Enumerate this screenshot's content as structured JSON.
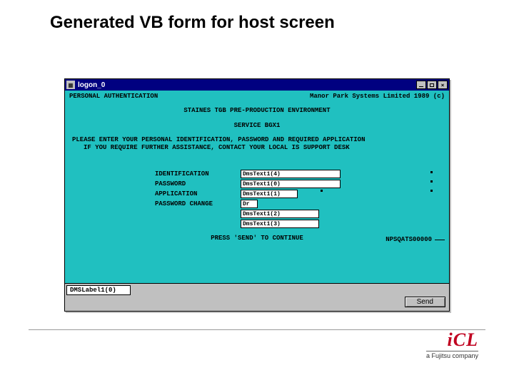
{
  "slide": {
    "title": "Generated VB form for host screen",
    "logo_main": "iCL",
    "logo_sub": "a Fujitsu company"
  },
  "window": {
    "title": "logon_0",
    "controls": {
      "min": "_",
      "max": "□",
      "close": "×"
    }
  },
  "host": {
    "header_left": "PERSONAL AUTHENTICATION",
    "header_right": "Manor Park Systems Limited 1989 (c)",
    "env_line": "STAINES TGB PRE-PRODUCTION ENVIRONMENT",
    "service_line": "SERVICE BGX1",
    "instruct1": "PLEASE ENTER YOUR PERSONAL IDENTIFICATION, PASSWORD AND REQUIRED APPLICATION",
    "instruct2": "IF YOU REQUIRE FURTHER ASSISTANCE, CONTACT YOUR LOCAL IS SUPPORT DESK",
    "labels": {
      "identification": "IDENTIFICATION",
      "password": "PASSWORD",
      "application": "APPLICATION",
      "password_change": "PASSWORD CHANGE"
    },
    "fields": {
      "identification": "DmsText1(4)",
      "password": "DmsText1(0)",
      "application": "DmsText1(1)",
      "password_change": "Dr",
      "extra1": "DmsText1(2)",
      "extra2": "DmsText1(3)"
    },
    "press_line": "PRESS 'SEND' TO CONTINUE",
    "status_br": "NPSQATS00000"
  },
  "footer": {
    "dms_label": "DMSLabel1(0)",
    "send_button": "Send"
  }
}
